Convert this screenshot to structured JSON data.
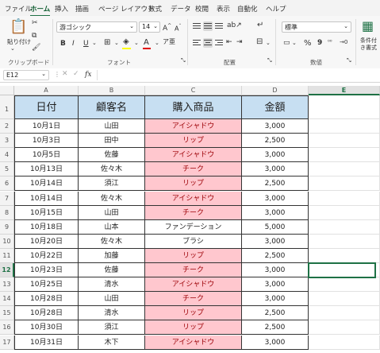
{
  "menu": {
    "tabs": [
      "ファイル",
      "ホーム",
      "挿入",
      "描画",
      "ページ レイアウト",
      "数式",
      "データ",
      "校閲",
      "表示",
      "自動化",
      "ヘルプ"
    ],
    "active_tab": "ホーム"
  },
  "ribbon": {
    "paste_label": "貼り付け",
    "clipboard_group": "クリップボード",
    "font_name": "游ゴシック",
    "font_size": "14",
    "font_group": "フォント",
    "alignment_group": "配置",
    "number_format": "標準",
    "number_group": "数値",
    "conditional_format_label": "条件付き書式",
    "bold": "B",
    "italic": "I",
    "underline": "U",
    "grow_font": "A",
    "shrink_font": "A",
    "font_color_glyph": "A",
    "percent": "%",
    "comma": "9",
    "inc_decimal": "⁰⁰",
    "dec_decimal": "→0"
  },
  "formula_bar": {
    "name_box": "E12",
    "fx": "fx",
    "formula": ""
  },
  "columns": [
    "A",
    "B",
    "C",
    "D",
    "E"
  ],
  "selected_column": "E",
  "selected_row": 12,
  "colors": {
    "header_fill": "#c7dff2",
    "highlight_fill": "#ffc7ce",
    "highlight_text": "#9c0006",
    "accent": "#1e7145"
  },
  "table": {
    "headers": [
      "日付",
      "顧客名",
      "購入商品",
      "金額"
    ],
    "rows": [
      {
        "date": "10月1日",
        "customer": "山田",
        "product": "アイシャドウ",
        "amount": "3,000",
        "highlight": true
      },
      {
        "date": "10月3日",
        "customer": "田中",
        "product": "リップ",
        "amount": "2,500",
        "highlight": true
      },
      {
        "date": "10月5日",
        "customer": "佐藤",
        "product": "アイシャドウ",
        "amount": "3,000",
        "highlight": true
      },
      {
        "date": "10月13日",
        "customer": "佐々木",
        "product": "チーク",
        "amount": "3,000",
        "highlight": true
      },
      {
        "date": "10月14日",
        "customer": "須江",
        "product": "リップ",
        "amount": "2,500",
        "highlight": true
      },
      {
        "date": "10月14日",
        "customer": "佐々木",
        "product": "アイシャドウ",
        "amount": "3,000",
        "highlight": true
      },
      {
        "date": "10月15日",
        "customer": "山田",
        "product": "チーク",
        "amount": "3,000",
        "highlight": true
      },
      {
        "date": "10月18日",
        "customer": "山本",
        "product": "ファンデーション",
        "amount": "5,000",
        "highlight": false
      },
      {
        "date": "10月20日",
        "customer": "佐々木",
        "product": "ブラシ",
        "amount": "3,000",
        "highlight": false
      },
      {
        "date": "10月22日",
        "customer": "加藤",
        "product": "リップ",
        "amount": "2,500",
        "highlight": true
      },
      {
        "date": "10月23日",
        "customer": "佐藤",
        "product": "チーク",
        "amount": "3,000",
        "highlight": true
      },
      {
        "date": "10月25日",
        "customer": "清水",
        "product": "アイシャドウ",
        "amount": "3,000",
        "highlight": true
      },
      {
        "date": "10月28日",
        "customer": "山田",
        "product": "チーク",
        "amount": "3,000",
        "highlight": true
      },
      {
        "date": "10月28日",
        "customer": "清水",
        "product": "リップ",
        "amount": "2,500",
        "highlight": true
      },
      {
        "date": "10月30日",
        "customer": "須江",
        "product": "リップ",
        "amount": "2,500",
        "highlight": true
      },
      {
        "date": "10月31日",
        "customer": "木下",
        "product": "アイシャドウ",
        "amount": "3,000",
        "highlight": true
      }
    ]
  }
}
